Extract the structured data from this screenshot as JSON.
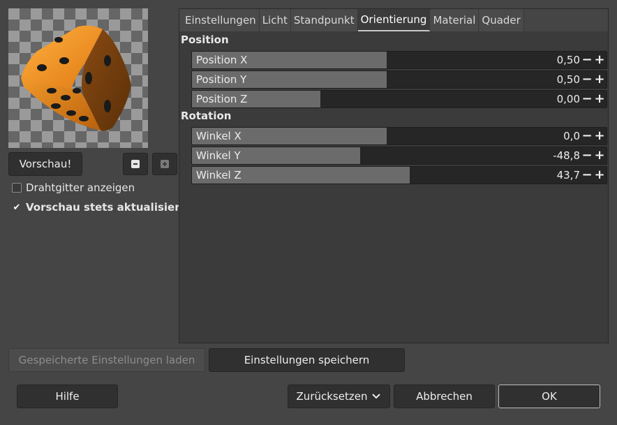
{
  "preview": {
    "button_label": "Vorschau!",
    "zoom_out_icon": "zoom-out-icon",
    "zoom_in_icon": "zoom-in-icon"
  },
  "options": {
    "wireframe_label": "Drahtgitter anzeigen",
    "wireframe_checked": false,
    "autoupdate_label": "Vorschau stets aktualisieren",
    "autoupdate_checked": true
  },
  "tabs": [
    {
      "label": "Einstellungen",
      "active": false
    },
    {
      "label": "Licht",
      "active": false
    },
    {
      "label": "Standpunkt",
      "active": false
    },
    {
      "label": "Orientierung",
      "active": true
    },
    {
      "label": "Material",
      "active": false
    },
    {
      "label": "Quader",
      "active": false
    }
  ],
  "orientation": {
    "position_title": "Position",
    "rotation_title": "Rotation",
    "position": [
      {
        "label": "Position X",
        "value": "0,50",
        "fraction": 0.47
      },
      {
        "label": "Position Y",
        "value": "0,50",
        "fraction": 0.47
      },
      {
        "label": "Position Z",
        "value": "0,00",
        "fraction": 0.31
      }
    ],
    "rotation": [
      {
        "label": "Winkel X",
        "value": "0,0",
        "fraction": 0.47
      },
      {
        "label": "Winkel Y",
        "value": "-48,8",
        "fraction": 0.405
      },
      {
        "label": "Winkel Z",
        "value": "43,7",
        "fraction": 0.526
      }
    ]
  },
  "bottom": {
    "load_label": "Gespeicherte Einstellungen laden",
    "save_label": "Einstellungen speichern",
    "help_label": "Hilfe",
    "reset_label": "Zurücksetzen",
    "cancel_label": "Abbrechen",
    "ok_label": "OK"
  },
  "colors": {
    "dice_orange": "#f0901c",
    "dice_dark": "#6e3c10",
    "pip": "#1a1a1a"
  }
}
